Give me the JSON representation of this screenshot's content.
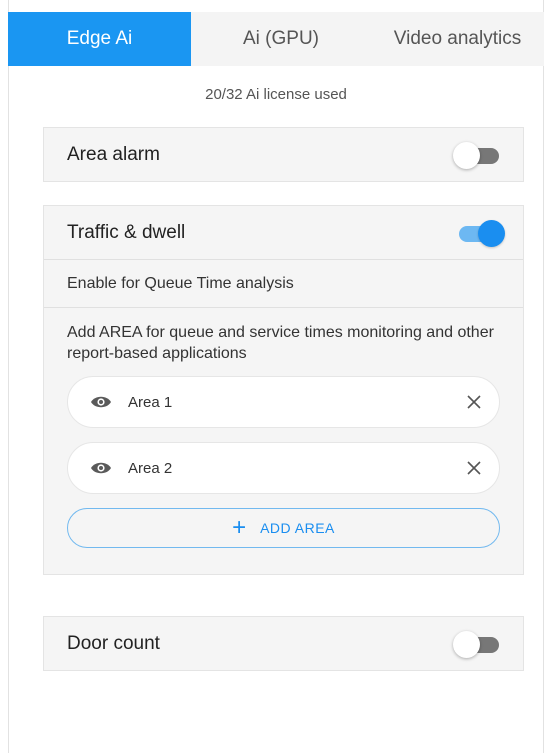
{
  "tabs": [
    {
      "label": "Edge Ai",
      "active": true
    },
    {
      "label": "Ai (GPU)",
      "active": false
    },
    {
      "label": "Video analytics",
      "active": false
    }
  ],
  "license_text": "20/32 Ai license used",
  "area_alarm": {
    "title": "Area alarm",
    "enabled": false
  },
  "traffic_dwell": {
    "title": "Traffic & dwell",
    "enabled": true,
    "queue_label": "Enable for Queue Time analysis",
    "description": "Add AREA for queue and service times monitoring and other report-based applications",
    "areas": [
      {
        "name": "Area 1",
        "icon": "eye-icon"
      },
      {
        "name": "Area 2",
        "icon": "eye-icon"
      }
    ],
    "add_label": "ADD AREA"
  },
  "door_count": {
    "title": "Door count",
    "enabled": false
  },
  "colors": {
    "accent": "#1a96f2",
    "toggle_on": "#1a8ef0",
    "toggle_off_track": "#777777"
  }
}
